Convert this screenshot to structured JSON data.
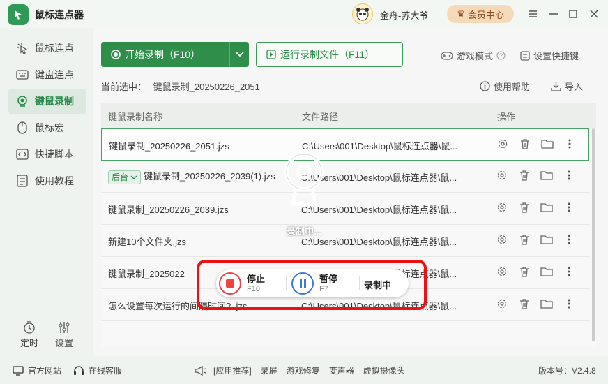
{
  "app": {
    "title": "鼠标连点器",
    "username": "金舟-苏大爷",
    "vip_label": "会员中心"
  },
  "sidebar": {
    "items": [
      {
        "label": "鼠标连点",
        "icon": "cursor-click-icon"
      },
      {
        "label": "键盘连点",
        "icon": "keyboard-icon"
      },
      {
        "label": "键鼠录制",
        "icon": "record-icon",
        "active": true
      },
      {
        "label": "鼠标宏",
        "icon": "mouse-icon"
      },
      {
        "label": "快捷脚本",
        "icon": "script-icon"
      },
      {
        "label": "使用教程",
        "icon": "tutorial-icon"
      }
    ],
    "timer_label": "定时",
    "settings_label": "设置"
  },
  "toolbar": {
    "start_label": "开始录制（F10）",
    "run_label": "运行录制文件（F11）",
    "game_mode_label": "游戏模式",
    "shortcut_label": "设置快捷键",
    "help_label": "使用帮助",
    "import_label": "导入"
  },
  "current": {
    "prefix": "当前选中：",
    "value": "键鼠录制_20250226_2051"
  },
  "table": {
    "headers": [
      "键鼠录制名称",
      "文件路径",
      "操作"
    ],
    "rows": [
      {
        "name": "键鼠录制_20250226_2051.jzs",
        "path": "C:\\Users\\001\\Desktop\\鼠标连点器\\鼠...",
        "badge": ""
      },
      {
        "name": "键鼠录制_20250226_2039(1).jzs",
        "path": "C:\\Users\\001\\Desktop\\鼠标连点器\\鼠...",
        "badge": "后台"
      },
      {
        "name": "键鼠录制_20250226_2039.jzs",
        "path": "C:\\Users\\001\\Desktop\\鼠标连点器\\鼠...",
        "badge": ""
      },
      {
        "name": "新建10个文件夹.jzs",
        "path": "C:\\Users\\001\\Desktop\\鼠标连点器\\鼠...",
        "badge": ""
      },
      {
        "name": "键鼠录制_2025022",
        "path": "C:\\Users\\001\\Desktop\\鼠标连点器\\鼠...",
        "badge": ""
      },
      {
        "name": "怎么设置每次运行的间隔时间?..jzs",
        "path": "C:\\Users\\001\\Desktop\\鼠标连点器\\鼠...",
        "badge": ""
      }
    ]
  },
  "overlay": {
    "status": "录制中..."
  },
  "recorder": {
    "stop_label": "停止",
    "stop_key": "F10",
    "pause_label": "暂停",
    "pause_key": "F7",
    "state_label": "录制中"
  },
  "footer": {
    "website": "官方网站",
    "service": "在线客服",
    "recommend": "[应用推荐]",
    "links": [
      "录屏",
      "游戏修复",
      "变声器",
      "虚拟摄像头"
    ],
    "version": "版本号：V2.4.8"
  },
  "colors": {
    "accent": "#2f8f4a",
    "highlight_frame": "#e11111"
  }
}
